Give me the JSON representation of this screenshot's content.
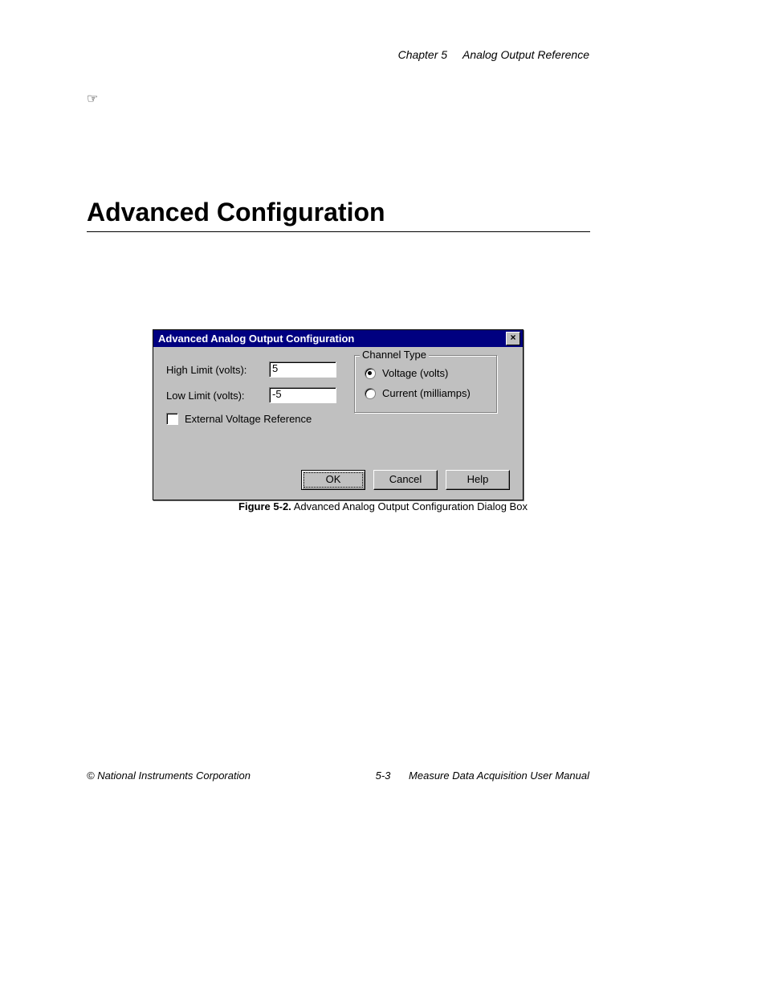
{
  "header": {
    "chapter": "Chapter 5",
    "title": "Analog Output Reference"
  },
  "note_icon": "☞",
  "heading": "Advanced Configuration",
  "dialog": {
    "title": "Advanced Analog Output Configuration",
    "close_glyph": "×",
    "high_limit_label": "High Limit (volts):",
    "high_limit_value": "5",
    "low_limit_label": "Low Limit (volts):",
    "low_limit_value": "-5",
    "external_ref_label": "External Voltage Reference",
    "external_ref_checked": false,
    "group_title": "Channel Type",
    "radio_voltage_label": "Voltage (volts)",
    "radio_voltage_selected": true,
    "radio_current_label": "Current (milliamps)",
    "radio_current_selected": false,
    "ok_label": "OK",
    "cancel_label": "Cancel",
    "help_label": "Help"
  },
  "caption_label": "Figure 5-2.",
  "caption_text": " Advanced Analog Output Configuration Dialog Box",
  "footer": {
    "left": "© National Instruments Corporation",
    "center": "5-3",
    "right": "Measure Data Acquisition User Manual"
  }
}
